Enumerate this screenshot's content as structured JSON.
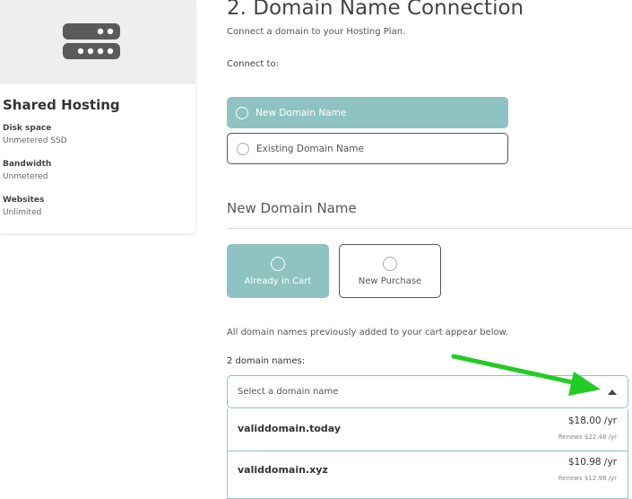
{
  "hosting_card": {
    "title": "Shared Hosting",
    "icon": "server-icon",
    "specs": [
      {
        "label": "Disk space",
        "value": "Unmetered SSD"
      },
      {
        "label": "Bandwidth",
        "value": "Unmetered"
      },
      {
        "label": "Websites",
        "value": "Unlimited"
      }
    ]
  },
  "section": {
    "title": "2. Domain Name Connection",
    "subtitle": "Connect a domain to your Hosting Plan.",
    "connect_label": "Connect to:",
    "connect_options": [
      {
        "label": "New Domain Name",
        "selected": true
      },
      {
        "label": "Existing Domain Name",
        "selected": false
      }
    ]
  },
  "new_domain": {
    "title": "New Domain Name",
    "options": [
      {
        "label": "Already in Cart",
        "selected": true
      },
      {
        "label": "New Purchase",
        "selected": false
      }
    ],
    "note": "All domain names previously added to your cart appear below.",
    "count_label": "2 domain names:",
    "select_placeholder": "Select a domain name",
    "domains": [
      {
        "name": "validdomain.today",
        "price": "$18.00 /yr",
        "renews": "Renews $22.48 /yr"
      },
      {
        "name": "validdomain.xyz",
        "price": "$10.98 /yr",
        "renews": "Renews $12.98 /yr"
      }
    ]
  },
  "colors": {
    "accent": "#8fc3c1",
    "annotation_arrow": "#22cc22"
  }
}
